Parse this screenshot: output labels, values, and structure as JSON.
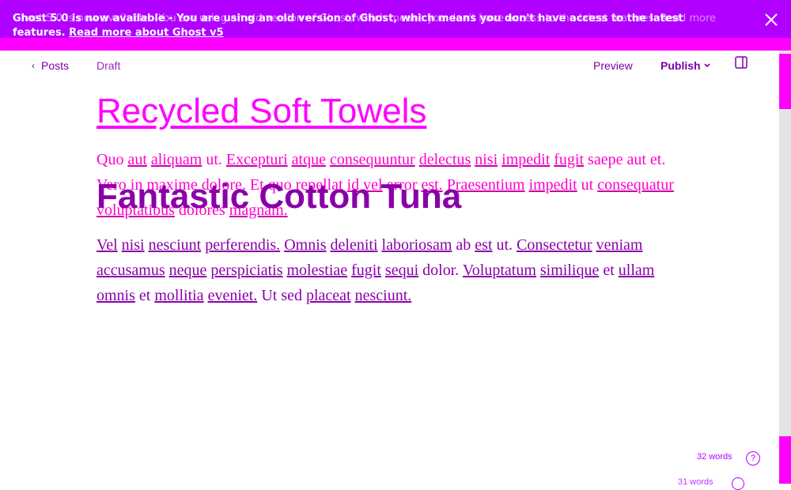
{
  "banner": {
    "headline": "Ghost 5.0 is now available",
    "message": "- You are using an old version of Ghost, which means you don't have access to the latest features.",
    "link": "Read more about Ghost v5",
    "ghost_text": "Ghost 5.0 is now available - You are using an old version of Ghost, which means you don't have access to the latest features. Read more",
    "close_icon": "close-icon"
  },
  "toolbar": {
    "back_label": "Posts",
    "status": "Draft",
    "preview_label": "Preview",
    "publish_label": "Publish"
  },
  "post": {
    "title": "Recycled Soft Towels",
    "overlay_title": "Fantastic Cotton Tuna",
    "paragraph1": [
      {
        "t": "Quo",
        "u": false
      },
      {
        "t": "aut",
        "u": true
      },
      {
        "t": "aliquam",
        "u": true
      },
      {
        "t": "ut.",
        "u": false
      },
      {
        "t": "Excepturi",
        "u": true
      },
      {
        "t": "atque",
        "u": true
      },
      {
        "t": "consequuntur",
        "u": true
      },
      {
        "t": "delectus",
        "u": true
      },
      {
        "t": "nisi",
        "u": true
      },
      {
        "t": "impedit",
        "u": true
      },
      {
        "t": "fugit",
        "u": true
      },
      {
        "t": "saepe",
        "u": false
      },
      {
        "t": "aut",
        "u": false
      },
      {
        "t": "et.",
        "u": false
      },
      {
        "t": "Vero",
        "u": false
      },
      {
        "t": "in",
        "u": false
      },
      {
        "t": "maxime",
        "u": false
      },
      {
        "t": "dolore.",
        "u": false
      },
      {
        "t": "Et",
        "u": false
      },
      {
        "t": "quo",
        "u": false
      },
      {
        "t": "repellat",
        "u": false
      },
      {
        "t": "id",
        "u": true
      },
      {
        "t": "vel",
        "u": true
      },
      {
        "t": "error",
        "u": false
      },
      {
        "t": "est.",
        "u": true
      },
      {
        "t": "Praesentium",
        "u": true
      },
      {
        "t": "impedit",
        "u": true
      },
      {
        "t": "ut",
        "u": false
      },
      {
        "t": "consequatur",
        "u": true
      },
      {
        "t": "voluptatibus",
        "u": true
      },
      {
        "t": "dolores",
        "u": false
      },
      {
        "t": "magnam.",
        "u": true
      }
    ],
    "paragraph2": [
      {
        "t": "Vel",
        "u": true
      },
      {
        "t": "nisi",
        "u": true
      },
      {
        "t": "nesciunt",
        "u": true
      },
      {
        "t": "perferendis.",
        "u": true
      },
      {
        "t": "Omnis",
        "u": true
      },
      {
        "t": "deleniti",
        "u": true
      },
      {
        "t": "laboriosam",
        "u": true
      },
      {
        "t": "ab",
        "u": false
      },
      {
        "t": "est",
        "u": true
      },
      {
        "t": "ut.",
        "u": false
      },
      {
        "t": "Consectetur",
        "u": true
      },
      {
        "t": "veniam",
        "u": true
      },
      {
        "t": "accusamus",
        "u": true
      },
      {
        "t": "neque",
        "u": true
      },
      {
        "t": "perspiciatis",
        "u": true
      },
      {
        "t": "molestiae",
        "u": true
      },
      {
        "t": "fugit",
        "u": true
      },
      {
        "t": "sequi",
        "u": true
      },
      {
        "t": "dolor.",
        "u": false
      },
      {
        "t": "Voluptatum",
        "u": true
      },
      {
        "t": "similique",
        "u": true
      },
      {
        "t": "et",
        "u": false
      },
      {
        "t": "ullam",
        "u": true
      },
      {
        "t": "omnis",
        "u": true
      },
      {
        "t": "et",
        "u": false
      },
      {
        "t": "mollitia",
        "u": true
      },
      {
        "t": "eveniet.",
        "u": true
      },
      {
        "t": "Ut",
        "u": false
      },
      {
        "t": "sed",
        "u": false
      },
      {
        "t": "placeat",
        "u": true
      },
      {
        "t": "nesciunt.",
        "u": true
      }
    ]
  },
  "footer": {
    "word_count": "32 words",
    "help_label": "?",
    "ghost_word_count": "31 words"
  },
  "colors": {
    "banner": "#b100ff",
    "accent": "#ff00ff",
    "text_purple": "#8a00a8"
  }
}
